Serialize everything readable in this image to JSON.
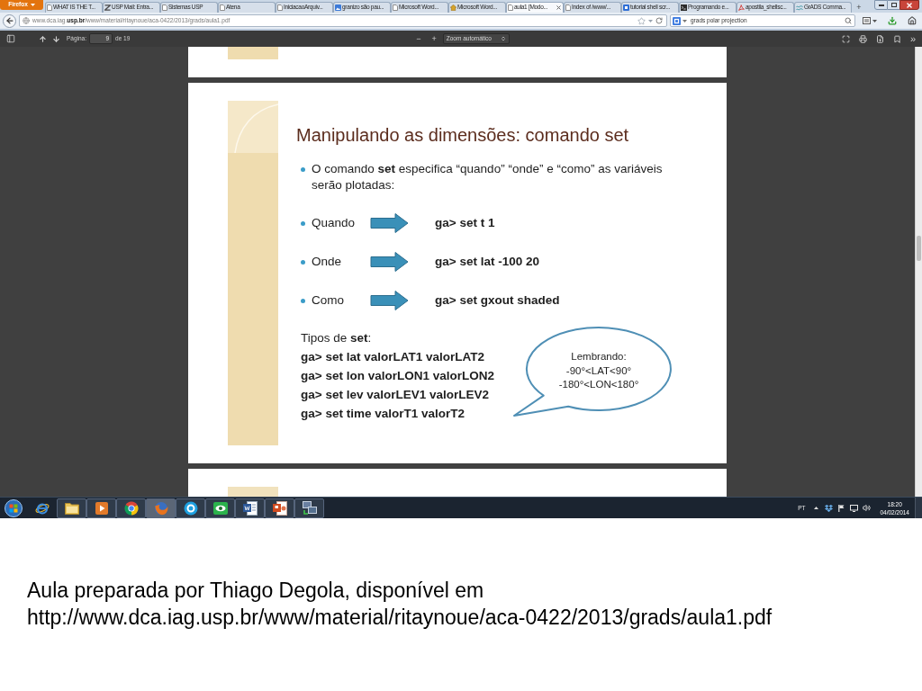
{
  "browser": {
    "menu_button": "Firefox",
    "tabs": [
      {
        "label": "WHAT IS THE T...",
        "kind": "page",
        "selected": false
      },
      {
        "label": "USP Mail: Entra...",
        "kind": "zigzag",
        "selected": false
      },
      {
        "label": "Sistemas USP",
        "kind": "page",
        "selected": false
      },
      {
        "label": "Atena",
        "kind": "page",
        "selected": false
      },
      {
        "label": "IniciacaoArquiv...",
        "kind": "page",
        "selected": false
      },
      {
        "label": "granizo são pau...",
        "kind": "picture",
        "selected": false
      },
      {
        "label": "Microsoft Word...",
        "kind": "page",
        "selected": false
      },
      {
        "label": "Microsoft Word...",
        "kind": "house",
        "selected": false
      },
      {
        "label": "aula1 [Modo...",
        "kind": "page",
        "selected": true
      },
      {
        "label": "Index of /www/...",
        "kind": "page",
        "selected": false
      },
      {
        "label": "tutorial shell scr...",
        "kind": "square",
        "selected": false
      },
      {
        "label": "Programando e...",
        "kind": "terminal",
        "selected": false
      },
      {
        "label": "apostila_shellsc...",
        "kind": "swirl",
        "selected": false
      },
      {
        "label": "GrADS Comma...",
        "kind": "waves",
        "selected": false
      }
    ],
    "new_tab": "+",
    "address": "www.dca.iag.**usp.br**/www/material/ritaynoue/aca-0422/2013/grads/aula1.pdf",
    "search": {
      "value": "grads polar projection"
    }
  },
  "pdf_viewer": {
    "page_label": "Página:",
    "page": "9",
    "page_count": "de 19",
    "zoom_out": "−",
    "zoom_in": "+",
    "zoom": "Zoom automático",
    "more_tools": "»",
    "slide": {
      "title": "Manipulando as dimensões: comando set",
      "intro": "O comando **set** especifica “quando” “onde” e “como” as variáveis serão plotadas:",
      "examples": [
        {
          "label": "Quando",
          "command": "ga> set t 1"
        },
        {
          "label": "Onde",
          "command": "ga> set lat -100 20"
        },
        {
          "label": "Como",
          "command": "ga> set gxout shaded"
        }
      ],
      "types_heading": "Tipos de **set**:",
      "types": [
        "ga> set lat valorLAT1 valorLAT2",
        "ga> set lon valorLON1 valorLON2",
        "ga> set lev valorLEV1 valorLEV2",
        "ga> set time valorT1 valorT2"
      ],
      "reminder": [
        "Lembrando:",
        "-90°<LAT<90°",
        "-180°<LON<180°"
      ]
    }
  },
  "taskbar": {
    "apps": [
      {
        "kind": "orb",
        "running": false,
        "selected": false
      },
      {
        "kind": "orbit",
        "running": false,
        "selected": false
      },
      {
        "kind": "folder",
        "running": true,
        "selected": false
      },
      {
        "kind": "player",
        "running": true,
        "selected": false
      },
      {
        "kind": "wheel",
        "running": true,
        "selected": false
      },
      {
        "kind": "globe",
        "running": true,
        "selected": true
      },
      {
        "kind": "circle",
        "running": true,
        "selected": false
      },
      {
        "kind": "eye",
        "running": true,
        "selected": false
      },
      {
        "kind": "document",
        "running": true,
        "selected": false
      },
      {
        "kind": "slides",
        "running": true,
        "selected": false
      },
      {
        "kind": "monitors",
        "running": true,
        "selected": false
      }
    ],
    "language": "PT",
    "time": "18:20",
    "date": "04/02/2014"
  },
  "caption": {
    "text": "Aula preparada por Thiago Degola, disponível em",
    "url": "http://www.dca.iag.usp.br/www/material/ritaynoue/aca-0422/2013/grads/aula1.pdf"
  }
}
